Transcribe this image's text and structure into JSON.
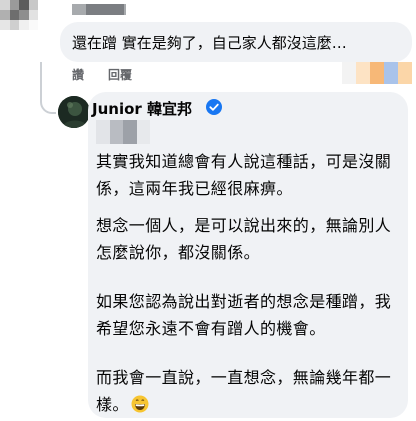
{
  "comment": {
    "text": "還在蹭 實在是夠了，自己家人都沒這麼…"
  },
  "actions": {
    "like_label": "讚",
    "reply_label": "回覆"
  },
  "reply": {
    "author_name": "Junior 韓宜邦",
    "verified_icon": "verified-badge-icon",
    "paragraphs": [
      "其實我知道總會有人說這種話，可是沒關係，這兩年我已經很麻痹。",
      "想念一個人，是可以說出來的，無論別人怎麼說你，都沒關係。",
      "如果您認為說出對逝者的想念是種蹭，我希望您永遠不會有蹭人的機會。",
      "而我會一直說，一直想念，無論幾年都一樣。"
    ],
    "trailing_emoji": "grinning-face-emoji"
  },
  "colors": {
    "bubble_bg": "#f0f2f5",
    "verified_blue": "#1877f2",
    "secondary_text": "#65676b"
  }
}
